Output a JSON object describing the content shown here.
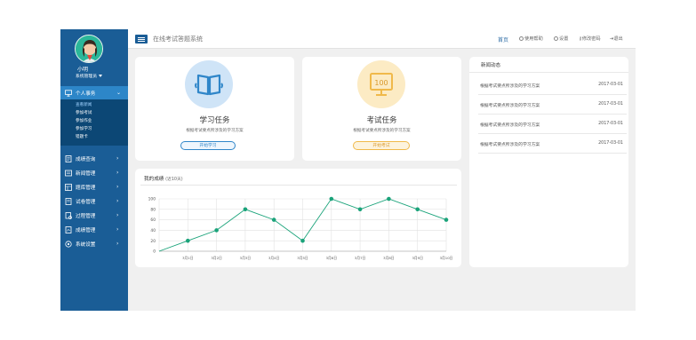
{
  "user": {
    "name": "小明",
    "role": "系统管理员"
  },
  "sidebar": {
    "active": {
      "label": "个人事务",
      "icon": "monitor-icon"
    },
    "submenu": [
      "查看新闻",
      "参加考试",
      "参加作业",
      "参加学习",
      "错题卡"
    ],
    "items": [
      {
        "label": "成绩查询",
        "icon": "grade-icon"
      },
      {
        "label": "新闻管理",
        "icon": "news-icon"
      },
      {
        "label": "题库管理",
        "icon": "question-bank-icon"
      },
      {
        "label": "试卷管理",
        "icon": "paper-icon"
      },
      {
        "label": "过程管理",
        "icon": "process-icon"
      },
      {
        "label": "成绩管理",
        "icon": "score-manage-icon"
      },
      {
        "label": "系统设置",
        "icon": "settings-icon"
      }
    ]
  },
  "header": {
    "title": "在线考试答题系统",
    "home": "首页",
    "help": "使用帮助",
    "settings": "设置",
    "change_password": "修改密码",
    "logout": "退出"
  },
  "study_task": {
    "title": "学习任务",
    "desc": "根据考试要点所涉及的学习方案",
    "button": "开始学习",
    "color": "#2f86c9"
  },
  "exam_task": {
    "title": "考试任务",
    "desc": "根据考试要点所涉及的学习方案",
    "button": "开始考试",
    "icon_text": "100",
    "color": "#f0b94a"
  },
  "news": {
    "title": "新闻动态",
    "items": [
      {
        "title": "根据考试要点所涉及的学习方案",
        "date": "2017-03-01"
      },
      {
        "title": "根据考试要点所涉及的学习方案",
        "date": "2017-03-01"
      },
      {
        "title": "根据考试要点所涉及的学习方案",
        "date": "2017-03-01"
      },
      {
        "title": "根据考试要点所涉及的学习方案",
        "date": "2017-03-01"
      }
    ]
  },
  "chart_data": {
    "type": "line",
    "title": "我的成绩",
    "subtitle": "(近10天)",
    "categories": [
      "3月1日",
      "3月2日",
      "3月3日",
      "3月4日",
      "3月5日",
      "3月6日",
      "3月7日",
      "3月8日",
      "3月9日",
      "3月10日"
    ],
    "series": [
      {
        "values": [
          0,
          20,
          40,
          80,
          60,
          20,
          100,
          80,
          100,
          80,
          60
        ]
      }
    ],
    "yticks": [
      0,
      20,
      40,
      60,
      80,
      100
    ],
    "ylim": [
      0,
      100
    ],
    "grid": true,
    "line_color": "#1aa37a"
  }
}
